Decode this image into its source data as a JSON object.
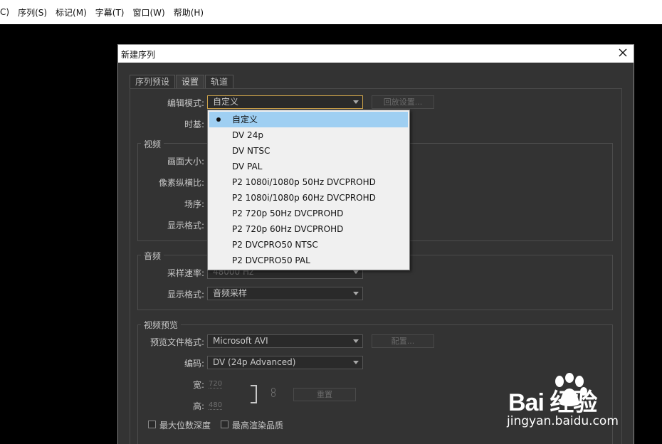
{
  "menubar": {
    "items": [
      "C)",
      "序列(S)",
      "标记(M)",
      "字幕(T)",
      "窗口(W)",
      "帮助(H)"
    ]
  },
  "dialog": {
    "title": "新建序列",
    "tabs": [
      "序列预设",
      "设置",
      "轨道"
    ],
    "active_tab": "设置",
    "settings": {
      "edit_mode_label": "编辑模式:",
      "edit_mode_value": "自定义",
      "playback_button": "回放设置...",
      "timebase_label": "时基:"
    },
    "video": {
      "group_label": "视频",
      "frame_size_label": "画面大小:",
      "pixel_aspect_label": "像素纵横比:",
      "fields_label": "场序:",
      "display_format_label": "显示格式:"
    },
    "audio": {
      "group_label": "音频",
      "sample_rate_label": "采样速率:",
      "sample_rate_value": "48000 Hz",
      "display_format_label": "显示格式:",
      "display_format_value": "音频采样"
    },
    "video_preview": {
      "group_label": "视频预览",
      "file_format_label": "预览文件格式:",
      "file_format_value": "Microsoft AVI",
      "configure_button": "配置...",
      "codec_label": "编码:",
      "codec_value": "DV (24p Advanced)",
      "width_label": "宽:",
      "width_value": "720",
      "height_label": "高:",
      "height_value": "480",
      "reset_button": "重置",
      "max_bit_depth_label": "最大位数深度",
      "max_render_quality_label": "最高渲染品质"
    },
    "dropdown": {
      "items": [
        "自定义",
        "DV 24p",
        "DV NTSC",
        "DV PAL",
        "P2 1080i/1080p 50Hz DVCPROHD",
        "P2 1080i/1080p 60Hz DVCPROHD",
        "P2 720p 50Hz DVCPROHD",
        "P2 720p 60Hz DVCPROHD",
        "P2 DVCPRO50 NTSC",
        "P2 DVCPRO50 PAL"
      ],
      "selected_index": 0
    }
  },
  "watermark": {
    "logo_text": "Bai 经验",
    "url": "jingyan.baidu.com"
  }
}
